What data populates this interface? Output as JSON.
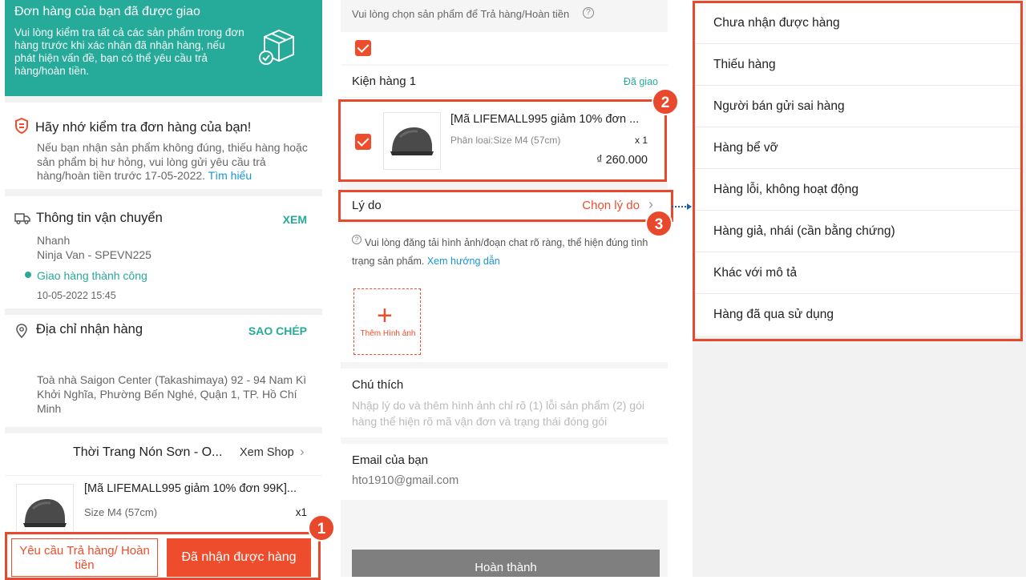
{
  "panel1": {
    "banner": {
      "title": "Đơn hàng của bạn đã được giao",
      "desc": "Vui lòng kiểm tra tất cả các sản phẩm trong đơn hàng trước khi xác nhận đã nhận hàng, nếu phát hiện vấn đề, bạn có thể yêu cầu trả hàng/hoàn tiền."
    },
    "reminder": {
      "title": "Hãy nhớ kiểm tra đơn hàng của bạn!",
      "desc": "Nếu bạn nhận sản phẩm không đúng, thiếu hàng hoặc sản phẩm bị hư hỏng, vui lòng gửi yêu cầu trả hàng/hoàn tiền trước 17-05-2022.",
      "link": "Tìm hiểu"
    },
    "shipping": {
      "title": "Thông tin vận chuyển",
      "action": "XEM",
      "method": "Nhanh",
      "carrier": "Ninja Van - SPEVN225",
      "status": "Giao hàng thành công",
      "time": "10-05-2022 15:45"
    },
    "address": {
      "title": "Địa chỉ nhận hàng",
      "action": "SAO CHÉP",
      "text": "Toà nhà Saigon Center (Takashimaya) 92 - 94 Nam Kì Khởi Nghĩa, Phường Bến Nghé, Quận 1, TP. Hồ Chí Minh"
    },
    "shop": {
      "name": "Thời Trang Nón Sơn - O...",
      "action": "Xem Shop"
    },
    "product": {
      "name": "[Mã LIFEMALL995 giảm 10% đơn 99K]...",
      "variant": "Size M4 (57cm)",
      "qty": "x1"
    },
    "buttons": {
      "return": "Yêu cầu Trả hàng/ Hoàn tiền",
      "received": "Đã nhận được hàng"
    }
  },
  "panel2": {
    "instruction": "Vui lòng chọn sản phẩm để Trả hàng/Hoàn tiền",
    "package": {
      "title": "Kiện hàng 1",
      "status": "Đã giao"
    },
    "product": {
      "name": "[Mã LIFEMALL995 giảm 10% đơn ...",
      "variant": "Phân loại:Size M4 (57cm)",
      "qty": "x 1",
      "price": "₫ 260.000"
    },
    "reason": {
      "label": "Lý do",
      "action": "Chọn lý do"
    },
    "upload": {
      "note": "Vui lòng đăng tải hình ảnh/đoạn chat rõ ràng, thể hiện đúng tình trạng sản phẩm.",
      "link": "Xem hướng dẫn",
      "add_label": "Thêm Hình ảnh"
    },
    "comment": {
      "label": "Chú thích",
      "placeholder": "Nhập lý do và thêm hình ảnh chỉ rõ (1) lỗi sản phẩm (2) gói hàng thể hiện rõ mã vận đơn và trạng thái đóng gói"
    },
    "email": {
      "label": "Email của bạn",
      "value": "hto1910@gmail.com"
    },
    "submit": "Hoàn thành"
  },
  "panel3": {
    "reasons": [
      "Chưa nhận được hàng",
      "Thiếu hàng",
      "Người bán gửi sai hàng",
      "Hàng bể vỡ",
      "Hàng lỗi, không hoạt động",
      "Hàng giả, nhái (cần bằng chứng)",
      "Khác với mô tả",
      "Hàng đã qua sử dụng"
    ]
  },
  "badges": [
    "1",
    "2",
    "3"
  ],
  "colors": {
    "accent": "#ee4d2d",
    "teal": "#26aa99",
    "link": "#1a96d4",
    "highlight": "#e8482c"
  }
}
